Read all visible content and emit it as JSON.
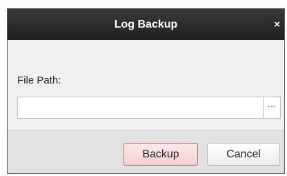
{
  "dialog": {
    "title": "Log Backup",
    "close_glyph": "×",
    "file_path_label": "File Path:",
    "file_path_value": "",
    "browse_label": "···",
    "backup_label": "Backup",
    "cancel_label": "Cancel"
  },
  "colors": {
    "titlebar": "#2a2a2a",
    "backup_border": "#d06464",
    "backup_fill": "#f6dcdc"
  }
}
